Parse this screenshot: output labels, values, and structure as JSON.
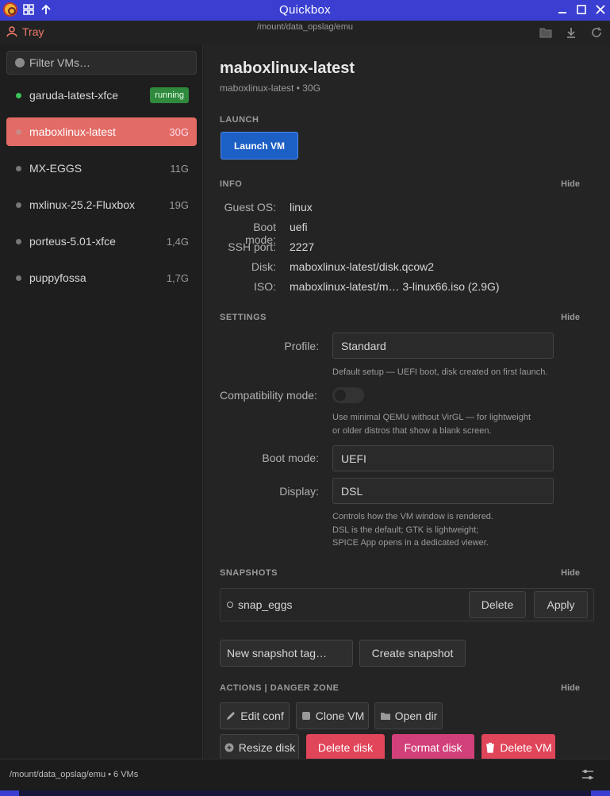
{
  "window": {
    "title": "Quickbox"
  },
  "toolbar": {
    "tray_label": "Tray",
    "path": "/mount/data_opslag/emu"
  },
  "sidebar": {
    "filter_placeholder": "Filter VMs…",
    "vms": [
      {
        "name": "garuda-latest-xfce",
        "badge": "running",
        "size": ""
      },
      {
        "name": "maboxlinux-latest",
        "size": "30G"
      },
      {
        "name": "MX-EGGS",
        "size": "11G"
      },
      {
        "name": "mxlinux-25.2-Fluxbox",
        "size": "19G"
      },
      {
        "name": "porteus-5.01-xfce",
        "size": "1,4G"
      },
      {
        "name": "puppyfossa",
        "size": "1,7G"
      }
    ]
  },
  "main": {
    "title": "maboxlinux-latest",
    "subtitle": "maboxlinux-latest • 30G",
    "launch_label": "LAUNCH",
    "launch_button": "Launch VM",
    "hide": "Hide",
    "info_label": "INFO",
    "info": [
      {
        "key": "Guest OS:",
        "value": "linux"
      },
      {
        "key": "Boot mode:",
        "value": "uefi"
      },
      {
        "key": "SSH port:",
        "value": "2227"
      },
      {
        "key": "Disk:",
        "value": "maboxlinux-latest/disk.qcow2"
      },
      {
        "key": "ISO:",
        "value": "maboxlinux-latest/m… 3-linux66.iso  (2.9G)"
      }
    ],
    "settings_label": "SETTINGS",
    "settings": {
      "profile_key": "Profile:",
      "profile_value": "Standard",
      "profile_hint": "Default setup — UEFI boot, disk created on first launch.",
      "compat_key": "Compatibility mode:",
      "compat_hint_1": "Use minimal QEMU without VirGL — for lightweight",
      "compat_hint_2": "or older distros that show a blank screen.",
      "boot_key": "Boot mode:",
      "boot_value": "UEFI",
      "display_key": "Display:",
      "display_value": "DSL",
      "display_hint_1": "Controls how the VM window is rendered.",
      "display_hint_2": "DSL is the default; GTK is lightweight;",
      "display_hint_3": "SPICE App opens in a dedicated viewer."
    },
    "snapshots_label": "SNAPSHOTS",
    "snapshot": {
      "name": "snap_eggs",
      "delete": "Delete",
      "apply": "Apply"
    },
    "new_snapshot_placeholder": "New snapshot tag…",
    "create_snapshot": "Create snapshot",
    "actions_label": "ACTIONS | DANGER ZONE",
    "actions": {
      "edit_conf": "Edit conf",
      "clone_vm": "Clone VM",
      "open_dir": "Open dir",
      "resize_disk": "Resize disk",
      "delete_disk": "Delete disk",
      "format_disk": "Format disk",
      "delete_vm": "Delete VM"
    }
  },
  "statusbar": {
    "text": "/mount/data_opslag/emu • 6 VMs"
  },
  "colors": {
    "accent": "#3a3fd1",
    "selected": "#e36b65",
    "launch": "#1c5fc5",
    "danger": "#e0455a",
    "danger_alt": "#d2407a",
    "running": "#3cc35a"
  }
}
